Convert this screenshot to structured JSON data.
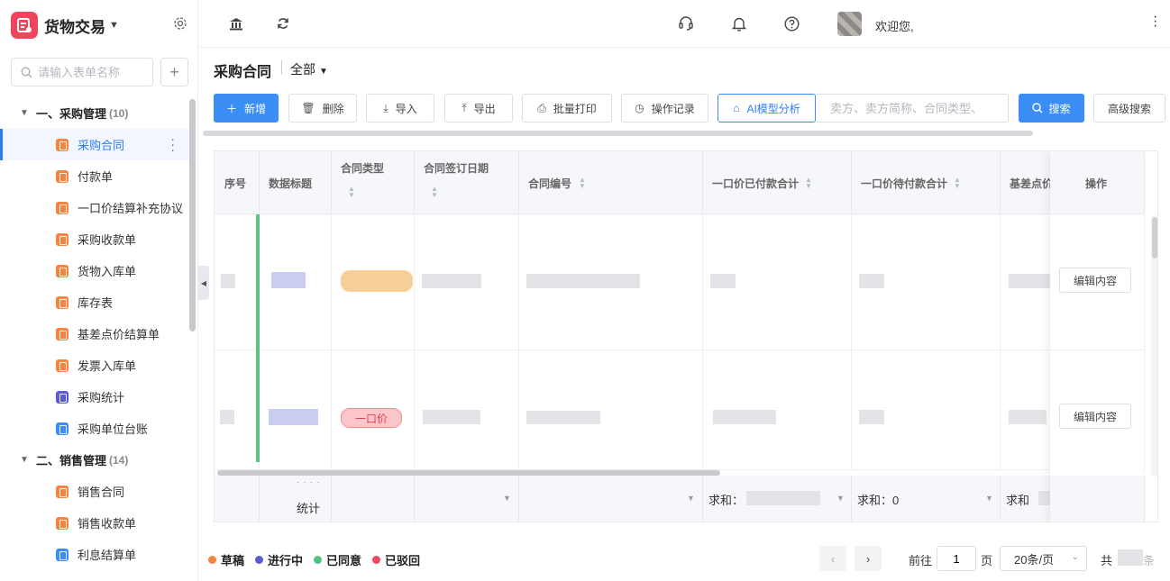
{
  "app": {
    "name": "货物交易",
    "brand_color": "#f0465c",
    "accent": "#2f7cf6"
  },
  "sidebar": {
    "search_placeholder": "请输入表单名称",
    "groups": [
      {
        "title": "一、采购管理",
        "count": "(10)",
        "items": [
          {
            "label": "采购合同",
            "icon_color": "#f5843f",
            "active": true
          },
          {
            "label": "付款单",
            "icon_color": "#f5843f"
          },
          {
            "label": "一口价结算补充协议",
            "icon_color": "#f5843f"
          },
          {
            "label": "采购收款单",
            "icon_color": "#f5843f"
          },
          {
            "label": "货物入库单",
            "icon_color": "#f5843f"
          },
          {
            "label": "库存表",
            "icon_color": "#f5843f"
          },
          {
            "label": "基差点价结算单",
            "icon_color": "#f5843f"
          },
          {
            "label": "发票入库单",
            "icon_color": "#f5843f"
          },
          {
            "label": "采购统计",
            "icon_color": "#5b5bd6"
          },
          {
            "label": "采购单位台账",
            "icon_color": "#3a8ef6"
          }
        ]
      },
      {
        "title": "二、销售管理",
        "count": "(14)",
        "items": [
          {
            "label": "销售合同",
            "icon_color": "#f5843f"
          },
          {
            "label": "销售收款单",
            "icon_color": "#f5843f"
          },
          {
            "label": "利息结算单",
            "icon_color": "#3a8ef6"
          }
        ]
      }
    ]
  },
  "topbar": {
    "welcome": "欢迎您,"
  },
  "page": {
    "title": "采购合同",
    "scope": "全部"
  },
  "toolbar": {
    "new": "新增",
    "delete": "删除",
    "import": "导入",
    "export": "导出",
    "batch_print": "批量打印",
    "op_log": "操作记录",
    "ai": "AI模型分析",
    "search_placeholder": "卖方、卖方简称、合同类型、",
    "search": "搜索",
    "advanced": "高级搜索"
  },
  "table": {
    "columns": {
      "seq": "序号",
      "data_title": "数据标题",
      "contract_type": "合同类型",
      "sign_date": "合同签订日期",
      "contract_no": "合同编号",
      "paid_total": "一口价已付款合计",
      "unpaid_total": "一口价待付款合计",
      "basis": "基差点价",
      "ops": "操作"
    },
    "rows": [
      {
        "type_tag": "",
        "edit": "编辑内容"
      },
      {
        "type_tag": "一口价",
        "edit": "编辑内容"
      }
    ],
    "footer": {
      "ellipsis": "· · · ·",
      "stats": "统计",
      "sum_prefix": "求和：",
      "sum_unpaid": "求和：0",
      "sum_basis": "求和"
    }
  },
  "legend": [
    {
      "label": "草稿",
      "color": "#f5843f"
    },
    {
      "label": "进行中",
      "color": "#5b5bd6"
    },
    {
      "label": "已同意",
      "color": "#52c27e"
    },
    {
      "label": "已驳回",
      "color": "#f0465c"
    }
  ],
  "pagination": {
    "goto": "前往",
    "page": "1",
    "page_unit": "页",
    "page_size": "20条/页",
    "total_prefix": "共",
    "total_suffix": "条"
  }
}
